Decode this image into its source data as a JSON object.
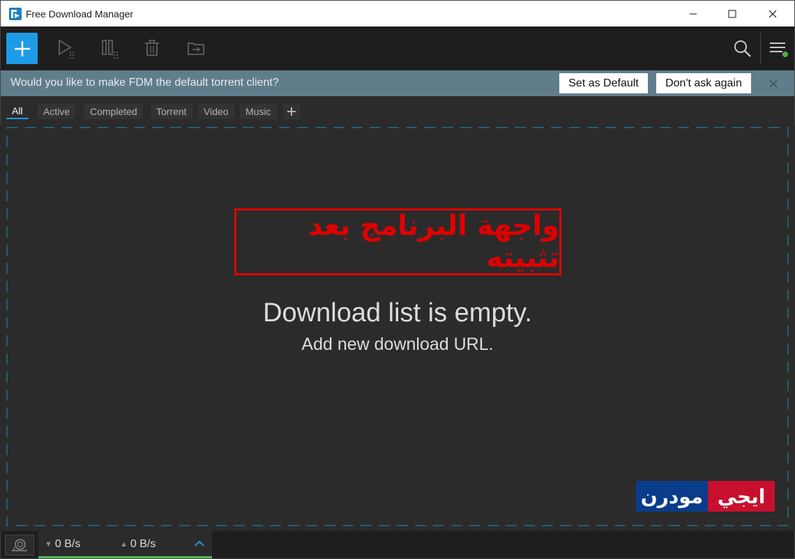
{
  "window": {
    "title": "Free Download Manager"
  },
  "toolbar": {
    "icons": [
      "plus-icon",
      "play-icon",
      "pause-icon",
      "trash-icon",
      "folder-move-icon",
      "search-icon",
      "menu-icon"
    ]
  },
  "notice": {
    "text": "Would you like to make FDM the default torrent client?",
    "set_default": "Set as Default",
    "dont_ask": "Don't ask again"
  },
  "tabs": [
    {
      "label": "All"
    },
    {
      "label": "Active"
    },
    {
      "label": "Completed"
    },
    {
      "label": "Torrent"
    },
    {
      "label": "Video"
    },
    {
      "label": "Music"
    }
  ],
  "main": {
    "empty_title": "Download list is empty.",
    "empty_sub": "Add new download URL."
  },
  "annotation": {
    "text": "واجهة البرنامج بعد تثبيته"
  },
  "logo": {
    "left": "مودرن",
    "right": "ايجي"
  },
  "status": {
    "down_speed": "0 B/s",
    "up_speed": "0 B/s"
  },
  "colors": {
    "accent": "#1e9be8",
    "notice_bg": "#607d8b",
    "annotation": "#e00000",
    "status_ok": "#5cb85c"
  }
}
